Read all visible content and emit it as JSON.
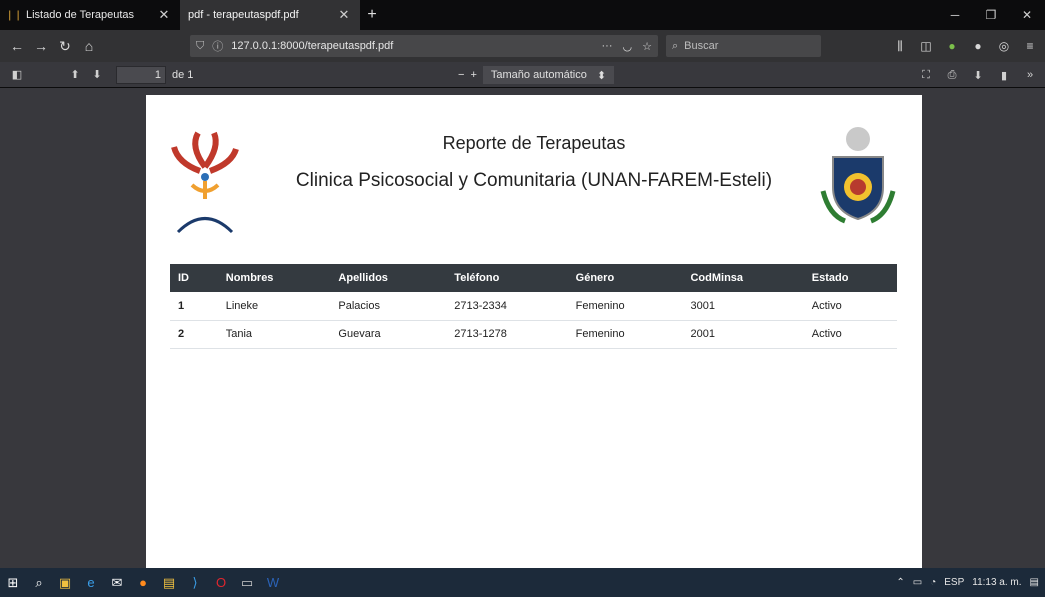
{
  "browser": {
    "tabs": [
      {
        "title": "Listado de Terapeutas",
        "active": false
      },
      {
        "title": "pdf - terapeutaspdf.pdf",
        "active": true
      }
    ],
    "url": "127.0.0.1:8000/terapeutaspdf.pdf",
    "search_placeholder": "Buscar"
  },
  "pdf_toolbar": {
    "page_current": "1",
    "page_total": "de 1",
    "zoom_label": "Tamaño automático"
  },
  "document": {
    "title": "Reporte de Terapeutas",
    "subtitle": "Clinica Psicosocial y Comunitaria (UNAN-FAREM-Esteli)",
    "table": {
      "columns": [
        "ID",
        "Nombres",
        "Apellidos",
        "Teléfono",
        "Género",
        "CodMinsa",
        "Estado"
      ],
      "rows": [
        [
          "1",
          "Lineke",
          "Palacios",
          "2713-2334",
          "Femenino",
          "3001",
          "Activo"
        ],
        [
          "2",
          "Tania",
          "Guevara",
          "2713-1278",
          "Femenino",
          "2001",
          "Activo"
        ]
      ]
    }
  },
  "taskbar": {
    "language": "ESP",
    "time": "11:13 a. m."
  },
  "colors": {
    "table_header": "#343a40",
    "viewer_bg": "#38383d",
    "taskbar": "#1c2a3a"
  }
}
